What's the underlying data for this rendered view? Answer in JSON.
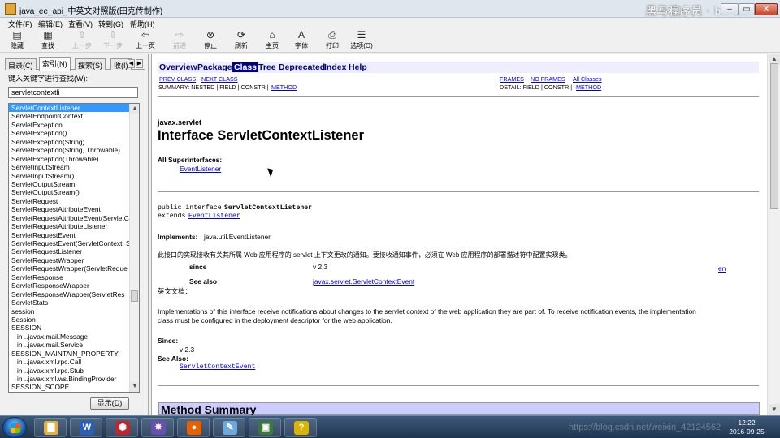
{
  "window": {
    "title": "java_ee_api_中英文对照版(田克传制作)",
    "watermark": "黑马程序员 · bilibili",
    "controls": [
      "‒",
      "▭",
      "✕"
    ]
  },
  "menu": [
    "文件(F)",
    "编辑(E)",
    "查看(V)",
    "转到(G)",
    "帮助(H)"
  ],
  "toolbar": [
    {
      "label": "隐藏",
      "icon": "hide-icon",
      "glyph": "▤",
      "enabled": true
    },
    {
      "label": "查找",
      "icon": "find-icon",
      "glyph": "▦",
      "enabled": true
    },
    {
      "label": "上一步",
      "icon": "arrow-up-icon",
      "glyph": "⇧",
      "enabled": false
    },
    {
      "label": "下一步",
      "icon": "arrow-down-icon",
      "glyph": "⇩",
      "enabled": false
    },
    {
      "label": "上一页",
      "icon": "back-icon",
      "glyph": "⇦",
      "enabled": true
    },
    {
      "label": "前进",
      "icon": "forward-icon",
      "glyph": "⇨",
      "enabled": false
    },
    {
      "label": "停止",
      "icon": "stop-icon",
      "glyph": "⊗",
      "enabled": true
    },
    {
      "label": "刷新",
      "icon": "refresh-icon",
      "glyph": "⟳",
      "enabled": true
    },
    {
      "label": "主页",
      "icon": "home-icon",
      "glyph": "⌂",
      "enabled": true
    },
    {
      "label": "字体",
      "icon": "font-icon",
      "glyph": "A",
      "enabled": true
    },
    {
      "label": "打印",
      "icon": "print-icon",
      "glyph": "⎙",
      "enabled": true
    },
    {
      "label": "选项(O)",
      "icon": "options-icon",
      "glyph": "☰",
      "enabled": true
    }
  ],
  "left": {
    "tabs": [
      "目录(C)",
      "索引(N)",
      "搜索(S)",
      "收(I)"
    ],
    "active_tab": 1,
    "keyword_label": "键入关键字进行查找(W):",
    "keyword_value": "servletcontextli",
    "show_button": "显示(D)",
    "index_items": [
      {
        "text": "ServletContextListener",
        "selected": true,
        "sub": false
      },
      {
        "text": "ServletEndpointContext",
        "selected": false,
        "sub": false
      },
      {
        "text": "ServletException",
        "selected": false,
        "sub": false
      },
      {
        "text": "ServletException()",
        "selected": false,
        "sub": false
      },
      {
        "text": "ServletException(String)",
        "selected": false,
        "sub": false
      },
      {
        "text": "ServletException(String, Throwable)",
        "selected": false,
        "sub": false
      },
      {
        "text": "ServletException(Throwable)",
        "selected": false,
        "sub": false
      },
      {
        "text": "ServletInputStream",
        "selected": false,
        "sub": false
      },
      {
        "text": "ServletInputStream()",
        "selected": false,
        "sub": false
      },
      {
        "text": "ServletOutputStream",
        "selected": false,
        "sub": false
      },
      {
        "text": "ServletOutputStream()",
        "selected": false,
        "sub": false
      },
      {
        "text": "ServletRequest",
        "selected": false,
        "sub": false
      },
      {
        "text": "ServletRequestAttributeEvent",
        "selected": false,
        "sub": false
      },
      {
        "text": "ServletRequestAttributeEvent(ServletCo",
        "selected": false,
        "sub": false
      },
      {
        "text": "ServletRequestAttributeListener",
        "selected": false,
        "sub": false
      },
      {
        "text": "ServletRequestEvent",
        "selected": false,
        "sub": false
      },
      {
        "text": "ServletRequestEvent(ServletContext, Se",
        "selected": false,
        "sub": false
      },
      {
        "text": "ServletRequestListener",
        "selected": false,
        "sub": false
      },
      {
        "text": "ServletRequestWrapper",
        "selected": false,
        "sub": false
      },
      {
        "text": "ServletRequestWrapper(ServletReque",
        "selected": false,
        "sub": false
      },
      {
        "text": "ServletResponse",
        "selected": false,
        "sub": false
      },
      {
        "text": "ServletResponseWrapper",
        "selected": false,
        "sub": false
      },
      {
        "text": "ServletResponseWrapper(ServletRes",
        "selected": false,
        "sub": false
      },
      {
        "text": "ServletStats",
        "selected": false,
        "sub": false
      },
      {
        "text": "session",
        "selected": false,
        "sub": false
      },
      {
        "text": "Session",
        "selected": false,
        "sub": false
      },
      {
        "text": "SESSION",
        "selected": false,
        "sub": false
      },
      {
        "text": "in ..javax.mail.Message",
        "selected": false,
        "sub": true
      },
      {
        "text": "in ..javax.mail.Service",
        "selected": false,
        "sub": true
      },
      {
        "text": "SESSION_MAINTAIN_PROPERTY",
        "selected": false,
        "sub": false
      },
      {
        "text": "in ..javax.xml.rpc.Call",
        "selected": false,
        "sub": true
      },
      {
        "text": "in ..javax.xml.rpc.Stub",
        "selected": false,
        "sub": true
      },
      {
        "text": "in ..javax.xml.ws.BindingProvider",
        "selected": false,
        "sub": true
      },
      {
        "text": "SESSION_SCOPE",
        "selected": false,
        "sub": false
      }
    ]
  },
  "doc": {
    "nav": [
      "Overview",
      "Package",
      "Class",
      "Tree",
      "Deprecated",
      "Index",
      "Help"
    ],
    "nav_current": "Class",
    "prev_class": "PREV CLASS",
    "next_class": "NEXT CLASS",
    "frames": "FRAMES",
    "no_frames": "NO FRAMES",
    "all_classes": "All Classes",
    "summary": "SUMMARY: NESTED | FIELD | CONSTR |",
    "summary_link": "METHOD",
    "detail": "DETAIL: FIELD | CONSTR |",
    "detail_link": "METHOD",
    "package": "javax.servlet",
    "title": "Interface ServletContextListener",
    "superinterfaces_label": "All Superinterfaces:",
    "superinterface": "EventListener",
    "decl_prefix": "public interface",
    "decl_name": "ServletContextListener",
    "decl_extends": "extends",
    "decl_extends_link": "EventListener",
    "implements_label": "Implements:",
    "implements_value": "java.util.EventListener",
    "cn_desc": "此接口的实现接收有关其所属 Web 应用程序的 servlet 上下文更改的通知。要接收通知事件，必须在 Web 应用程序的部署描述符中配置实现类。",
    "since_label": "since",
    "since_value": "v 2.3",
    "see_also_label": "See also",
    "see_also_value": "javax.servlet.ServletContextEvent",
    "en_link": "en",
    "en_doc_label": "英文文档：",
    "en_desc_1": "Implementations of this interface receive notifications about changes to the servlet context of the web application they are part of. To receive notification events, the implementation",
    "en_desc_2": "class must be configured in the deployment descriptor for the web application.",
    "since2_label": "Since:",
    "since2_value": "v 2.3",
    "seealso2_label": "See Also:",
    "seealso2_value": "ServletContextEvent",
    "method_summary": "Method Summary"
  },
  "taskbar": {
    "apps": [
      {
        "icon": "explorer-icon",
        "glyph": "▇",
        "color": "#e3b23c"
      },
      {
        "icon": "word-icon",
        "glyph": "W",
        "color": "#2b5fb4"
      },
      {
        "icon": "red-app-icon",
        "glyph": "⬢",
        "color": "#c0262b"
      },
      {
        "icon": "tool-icon",
        "glyph": "✸",
        "color": "#6a4fb0"
      },
      {
        "icon": "firefox-icon",
        "glyph": "●",
        "color": "#e66000"
      },
      {
        "icon": "paint-icon",
        "glyph": "✎",
        "color": "#6fa8dc"
      },
      {
        "icon": "app-window-icon",
        "glyph": "▣",
        "color": "#3b7a3b"
      },
      {
        "icon": "help-icon",
        "glyph": "?",
        "color": "#d9b400"
      }
    ],
    "watermark": "https://blog.csdn.net/weixin_42124562",
    "time": "12:22",
    "date": "2016-09-25"
  }
}
